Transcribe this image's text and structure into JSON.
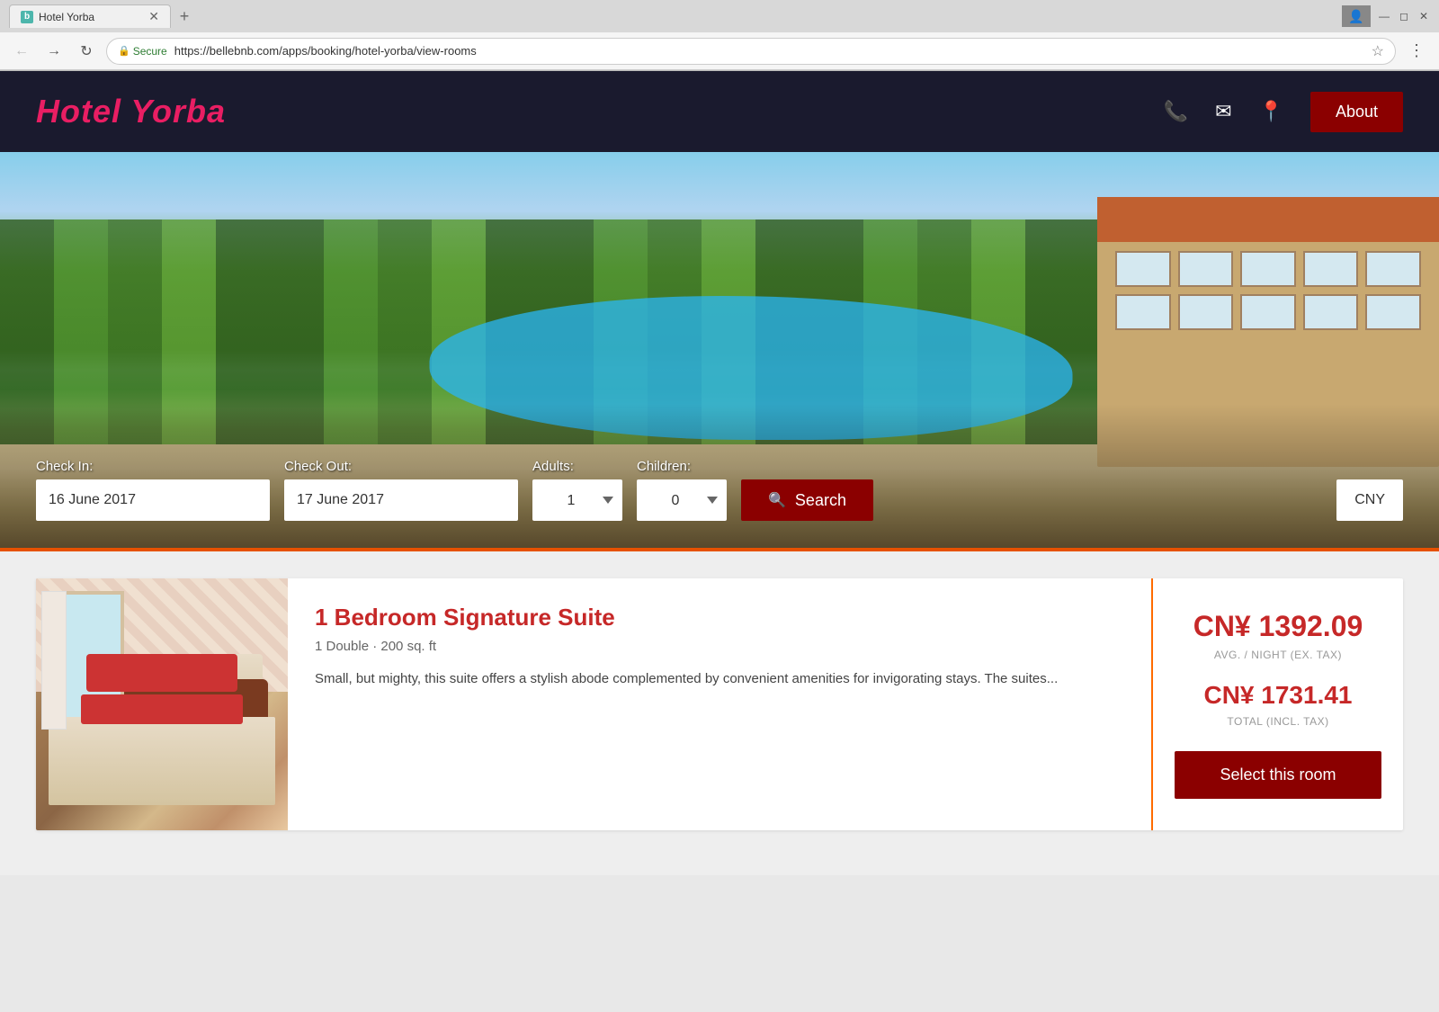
{
  "browser": {
    "tab_title": "Hotel Yorba",
    "tab_favicon": "b",
    "url": "https://bellebnb.com/apps/booking/hotel-yorba/view-rooms",
    "secure_label": "Secure"
  },
  "nav": {
    "logo": "Hotel Yorba",
    "about_label": "About",
    "phone_icon": "phone",
    "mail_icon": "mail",
    "location_icon": "location"
  },
  "booking": {
    "checkin_label": "Check In:",
    "checkin_value": "16 June 2017",
    "checkout_label": "Check Out:",
    "checkout_value": "17 June 2017",
    "adults_label": "Adults:",
    "adults_value": "1",
    "children_label": "Children:",
    "children_value": "0",
    "search_label": "Search",
    "currency_label": "CNY"
  },
  "rooms": [
    {
      "name": "1 Bedroom Signature Suite",
      "specs": "1 Double · 200 sq. ft",
      "description": "Small, but mighty, this suite offers a stylish abode complemented by convenient amenities for invigorating stays. The suites...",
      "price_per_night": "CN¥ 1392.09",
      "price_per_night_label": "AVG. / NIGHT (EX. TAX)",
      "price_total": "CN¥ 1731.41",
      "price_total_label": "TOTAL (INCL. TAX)",
      "select_label": "Select this room"
    }
  ]
}
